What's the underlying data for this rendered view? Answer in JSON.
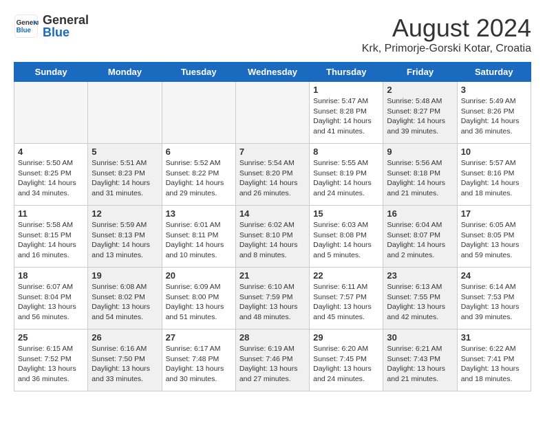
{
  "header": {
    "logo_general": "General",
    "logo_blue": "Blue",
    "month_year": "August 2024",
    "location": "Krk, Primorje-Gorski Kotar, Croatia"
  },
  "days_of_week": [
    "Sunday",
    "Monday",
    "Tuesday",
    "Wednesday",
    "Thursday",
    "Friday",
    "Saturday"
  ],
  "weeks": [
    [
      {
        "day": "",
        "info": "",
        "shaded": false
      },
      {
        "day": "",
        "info": "",
        "shaded": false
      },
      {
        "day": "",
        "info": "",
        "shaded": false
      },
      {
        "day": "",
        "info": "",
        "shaded": false
      },
      {
        "day": "1",
        "info": "Sunrise: 5:47 AM\nSunset: 8:28 PM\nDaylight: 14 hours and 41 minutes.",
        "shaded": false
      },
      {
        "day": "2",
        "info": "Sunrise: 5:48 AM\nSunset: 8:27 PM\nDaylight: 14 hours and 39 minutes.",
        "shaded": true
      },
      {
        "day": "3",
        "info": "Sunrise: 5:49 AM\nSunset: 8:26 PM\nDaylight: 14 hours and 36 minutes.",
        "shaded": false
      }
    ],
    [
      {
        "day": "4",
        "info": "Sunrise: 5:50 AM\nSunset: 8:25 PM\nDaylight: 14 hours and 34 minutes.",
        "shaded": false
      },
      {
        "day": "5",
        "info": "Sunrise: 5:51 AM\nSunset: 8:23 PM\nDaylight: 14 hours and 31 minutes.",
        "shaded": true
      },
      {
        "day": "6",
        "info": "Sunrise: 5:52 AM\nSunset: 8:22 PM\nDaylight: 14 hours and 29 minutes.",
        "shaded": false
      },
      {
        "day": "7",
        "info": "Sunrise: 5:54 AM\nSunset: 8:20 PM\nDaylight: 14 hours and 26 minutes.",
        "shaded": true
      },
      {
        "day": "8",
        "info": "Sunrise: 5:55 AM\nSunset: 8:19 PM\nDaylight: 14 hours and 24 minutes.",
        "shaded": false
      },
      {
        "day": "9",
        "info": "Sunrise: 5:56 AM\nSunset: 8:18 PM\nDaylight: 14 hours and 21 minutes.",
        "shaded": true
      },
      {
        "day": "10",
        "info": "Sunrise: 5:57 AM\nSunset: 8:16 PM\nDaylight: 14 hours and 18 minutes.",
        "shaded": false
      }
    ],
    [
      {
        "day": "11",
        "info": "Sunrise: 5:58 AM\nSunset: 8:15 PM\nDaylight: 14 hours and 16 minutes.",
        "shaded": false
      },
      {
        "day": "12",
        "info": "Sunrise: 5:59 AM\nSunset: 8:13 PM\nDaylight: 14 hours and 13 minutes.",
        "shaded": true
      },
      {
        "day": "13",
        "info": "Sunrise: 6:01 AM\nSunset: 8:11 PM\nDaylight: 14 hours and 10 minutes.",
        "shaded": false
      },
      {
        "day": "14",
        "info": "Sunrise: 6:02 AM\nSunset: 8:10 PM\nDaylight: 14 hours and 8 minutes.",
        "shaded": true
      },
      {
        "day": "15",
        "info": "Sunrise: 6:03 AM\nSunset: 8:08 PM\nDaylight: 14 hours and 5 minutes.",
        "shaded": false
      },
      {
        "day": "16",
        "info": "Sunrise: 6:04 AM\nSunset: 8:07 PM\nDaylight: 14 hours and 2 minutes.",
        "shaded": true
      },
      {
        "day": "17",
        "info": "Sunrise: 6:05 AM\nSunset: 8:05 PM\nDaylight: 13 hours and 59 minutes.",
        "shaded": false
      }
    ],
    [
      {
        "day": "18",
        "info": "Sunrise: 6:07 AM\nSunset: 8:04 PM\nDaylight: 13 hours and 56 minutes.",
        "shaded": false
      },
      {
        "day": "19",
        "info": "Sunrise: 6:08 AM\nSunset: 8:02 PM\nDaylight: 13 hours and 54 minutes.",
        "shaded": true
      },
      {
        "day": "20",
        "info": "Sunrise: 6:09 AM\nSunset: 8:00 PM\nDaylight: 13 hours and 51 minutes.",
        "shaded": false
      },
      {
        "day": "21",
        "info": "Sunrise: 6:10 AM\nSunset: 7:59 PM\nDaylight: 13 hours and 48 minutes.",
        "shaded": true
      },
      {
        "day": "22",
        "info": "Sunrise: 6:11 AM\nSunset: 7:57 PM\nDaylight: 13 hours and 45 minutes.",
        "shaded": false
      },
      {
        "day": "23",
        "info": "Sunrise: 6:13 AM\nSunset: 7:55 PM\nDaylight: 13 hours and 42 minutes.",
        "shaded": true
      },
      {
        "day": "24",
        "info": "Sunrise: 6:14 AM\nSunset: 7:53 PM\nDaylight: 13 hours and 39 minutes.",
        "shaded": false
      }
    ],
    [
      {
        "day": "25",
        "info": "Sunrise: 6:15 AM\nSunset: 7:52 PM\nDaylight: 13 hours and 36 minutes.",
        "shaded": false
      },
      {
        "day": "26",
        "info": "Sunrise: 6:16 AM\nSunset: 7:50 PM\nDaylight: 13 hours and 33 minutes.",
        "shaded": true
      },
      {
        "day": "27",
        "info": "Sunrise: 6:17 AM\nSunset: 7:48 PM\nDaylight: 13 hours and 30 minutes.",
        "shaded": false
      },
      {
        "day": "28",
        "info": "Sunrise: 6:19 AM\nSunset: 7:46 PM\nDaylight: 13 hours and 27 minutes.",
        "shaded": true
      },
      {
        "day": "29",
        "info": "Sunrise: 6:20 AM\nSunset: 7:45 PM\nDaylight: 13 hours and 24 minutes.",
        "shaded": false
      },
      {
        "day": "30",
        "info": "Sunrise: 6:21 AM\nSunset: 7:43 PM\nDaylight: 13 hours and 21 minutes.",
        "shaded": true
      },
      {
        "day": "31",
        "info": "Sunrise: 6:22 AM\nSunset: 7:41 PM\nDaylight: 13 hours and 18 minutes.",
        "shaded": false
      }
    ]
  ]
}
